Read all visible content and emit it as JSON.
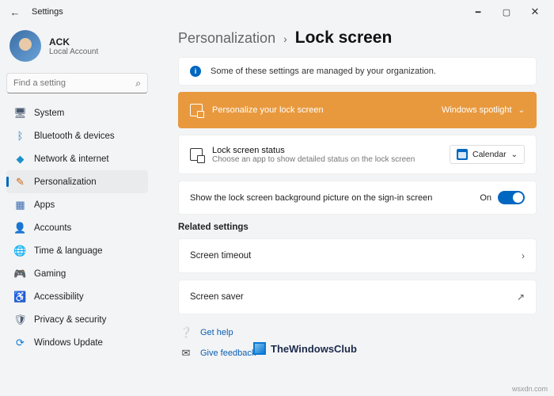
{
  "window": {
    "title": "Settings"
  },
  "profile": {
    "name": "ACK",
    "sub": "Local Account"
  },
  "search": {
    "placeholder": "Find a setting"
  },
  "sidebar": {
    "items": [
      {
        "label": "System"
      },
      {
        "label": "Bluetooth & devices"
      },
      {
        "label": "Network & internet"
      },
      {
        "label": "Personalization"
      },
      {
        "label": "Apps"
      },
      {
        "label": "Accounts"
      },
      {
        "label": "Time & language"
      },
      {
        "label": "Gaming"
      },
      {
        "label": "Accessibility"
      },
      {
        "label": "Privacy & security"
      },
      {
        "label": "Windows Update"
      }
    ]
  },
  "breadcrumb": {
    "parent": "Personalization",
    "current": "Lock screen"
  },
  "info_banner": "Some of these settings are managed by your organization.",
  "personalize": {
    "label": "Personalize your lock screen",
    "value": "Windows spotlight"
  },
  "status": {
    "title": "Lock screen status",
    "desc": "Choose an app to show detailed status on the lock screen",
    "value": "Calendar"
  },
  "signin_toggle": {
    "label": "Show the lock screen background picture on the sign-in screen",
    "state": "On"
  },
  "related_heading": "Related settings",
  "links": {
    "timeout": "Screen timeout",
    "saver": "Screen saver"
  },
  "help": {
    "get": "Get help",
    "feedback": "Give feedback"
  },
  "watermark": "TheWindowsClub",
  "domain_mark": "wsxdn.com"
}
